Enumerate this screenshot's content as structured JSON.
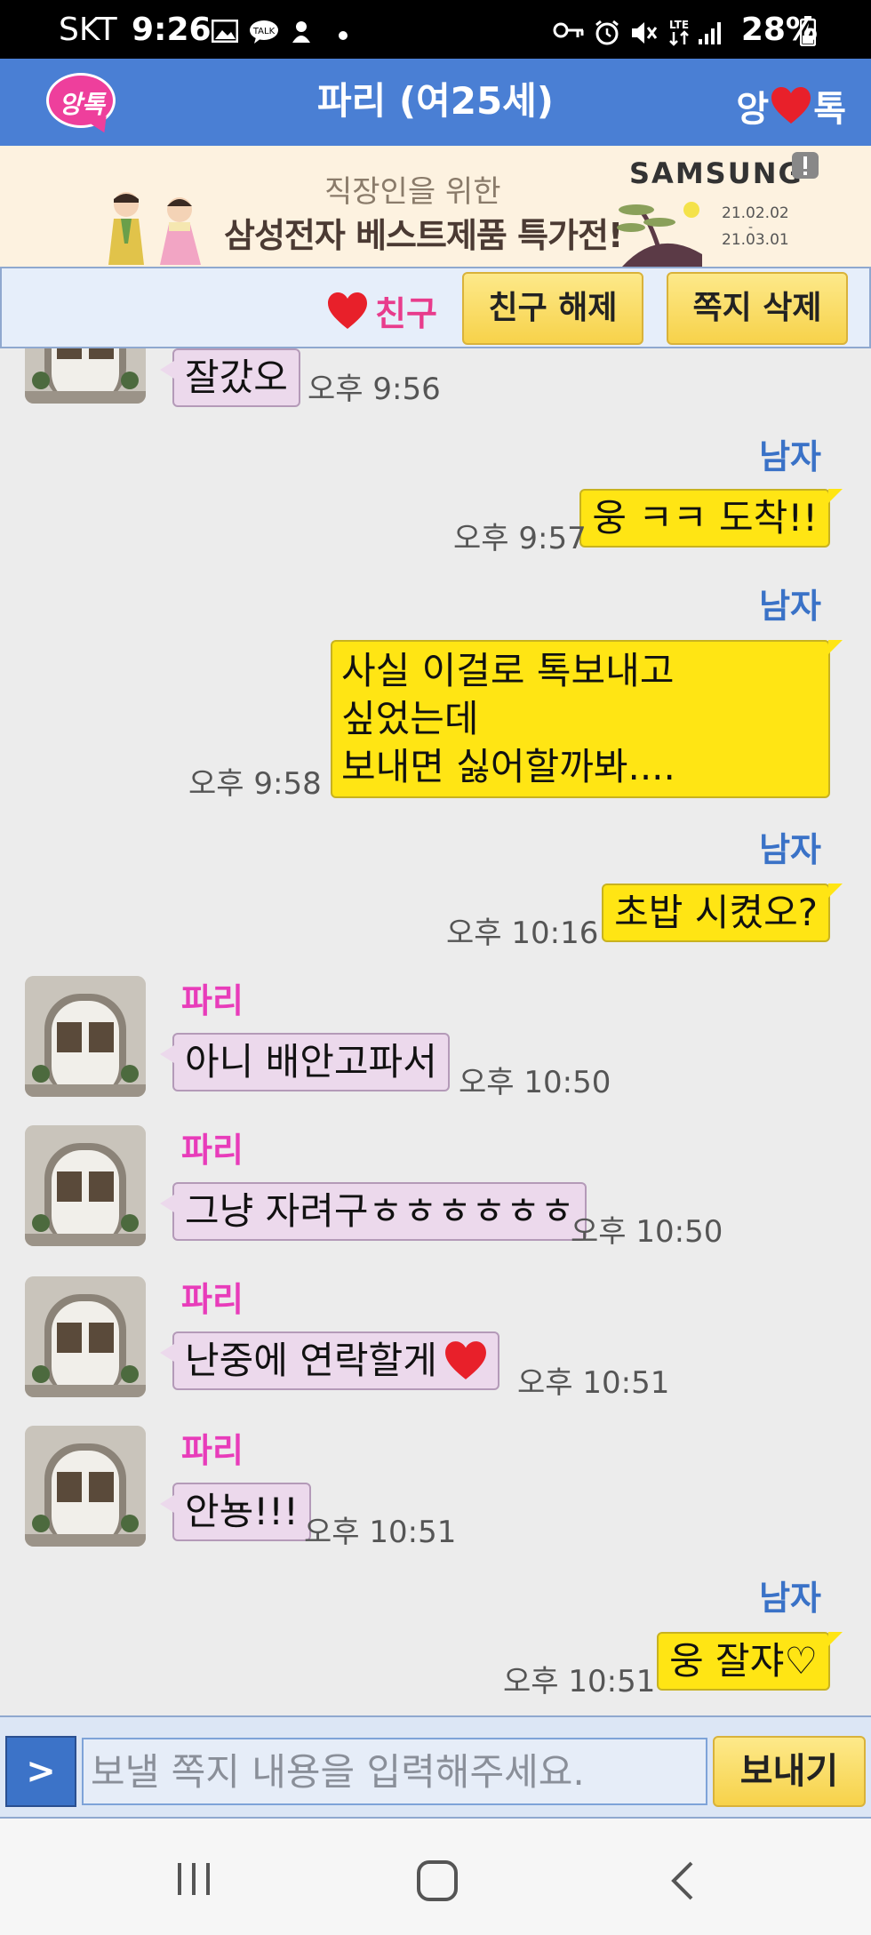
{
  "status_bar": {
    "carrier": "SKT",
    "time": "9:26",
    "battery": "28%"
  },
  "header": {
    "logo_text": "앙톡",
    "title": "파리 (여25세)",
    "brand_left": "앙",
    "brand_right": "톡",
    "brand_heart_color": "#e8202a",
    "bg_color": "#4a7fd4"
  },
  "banner": {
    "line1": "직장인을 위한",
    "line2": "삼성전자 베스트제품 특가전!",
    "sponsor": "SAMSUNG",
    "date_start": "21.02.02",
    "date_end": "21.03.01"
  },
  "friend_bar": {
    "status_label": "친구",
    "unfriend_label": "친구 해제",
    "delete_label": "쪽지 삭제"
  },
  "messages": [
    {
      "from": "them",
      "sender": "",
      "text": "잘갔오",
      "time": "오후 9:56"
    },
    {
      "from": "me",
      "sender": "남자",
      "text": "웅 ㅋㅋ 도착!!",
      "time": "오후 9:57"
    },
    {
      "from": "me",
      "sender": "남자",
      "lines": [
        "사실 이걸로 톡보내고",
        "싶었는데",
        "보내면 싫어할까봐...."
      ],
      "time": "오후 9:58"
    },
    {
      "from": "me",
      "sender": "남자",
      "text": "초밥 시켰오?",
      "time": "오후 10:16"
    },
    {
      "from": "them",
      "sender": "파리",
      "text": "아니 배안고파서",
      "time": "오후 10:50"
    },
    {
      "from": "them",
      "sender": "파리",
      "text": "그냥 자려구ㅎㅎㅎㅎㅎㅎ",
      "time": "오후 10:50"
    },
    {
      "from": "them",
      "sender": "파리",
      "text": "난중에 연락할게",
      "time": "오후 10:51"
    },
    {
      "from": "them",
      "sender": "파리",
      "text": "안뇽!!!",
      "time": "오후 10:51"
    },
    {
      "from": "me",
      "sender": "남자",
      "text": "웅 잘쟈♡",
      "time": "오후 10:51"
    }
  ],
  "composer": {
    "expand_label": ">",
    "placeholder": "보낼 쪽지 내용을 입력해주세요.",
    "send_label": "보내기"
  },
  "icons": {
    "status": [
      "gallery-icon",
      "kakaotalk-icon",
      "notification-icon",
      "key-icon",
      "alarm-icon",
      "mute-icon",
      "lte-icon",
      "signal-icon",
      "battery-charging-icon"
    ],
    "nav": [
      "recent-apps-icon",
      "home-icon",
      "back-icon"
    ]
  }
}
